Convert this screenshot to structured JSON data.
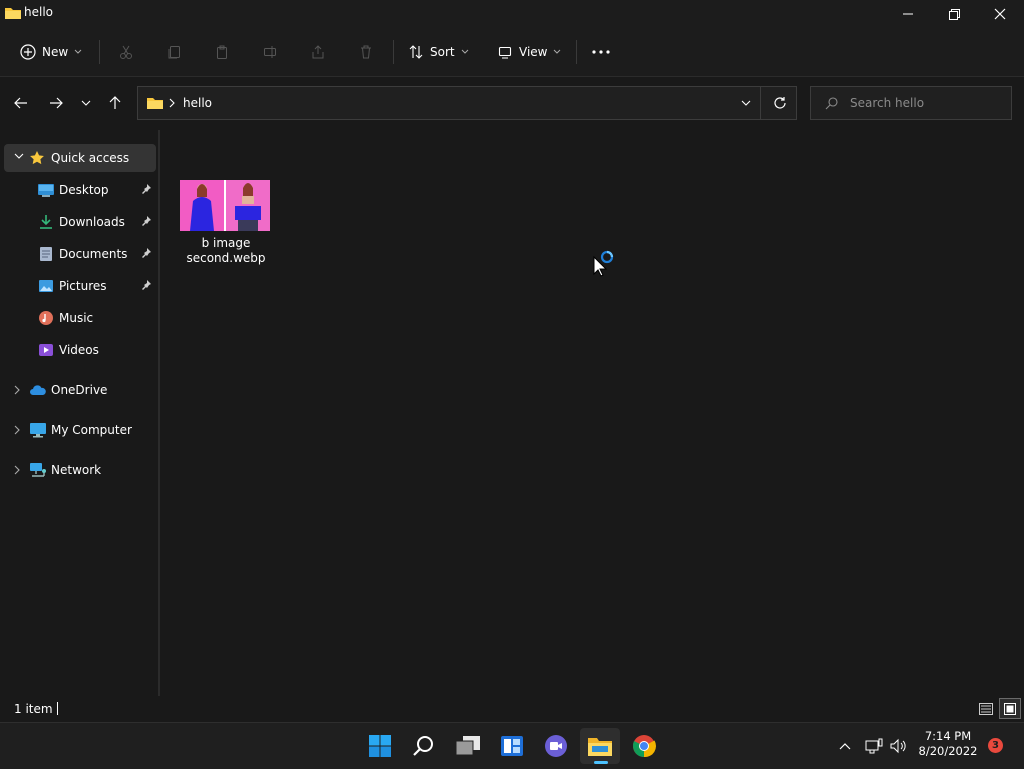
{
  "window": {
    "title": "hello"
  },
  "toolbar": {
    "new_label": "New",
    "sort_label": "Sort",
    "view_label": "View"
  },
  "address": {
    "crumb": "hello",
    "search_placeholder": "Search hello"
  },
  "sidebar": {
    "quick_access": "Quick access",
    "items": [
      {
        "label": "Desktop",
        "icon": "desktop-icon",
        "pinned": true
      },
      {
        "label": "Downloads",
        "icon": "download-icon",
        "pinned": true
      },
      {
        "label": "Documents",
        "icon": "document-icon",
        "pinned": true
      },
      {
        "label": "Pictures",
        "icon": "pictures-icon",
        "pinned": true
      },
      {
        "label": "Music",
        "icon": "music-icon",
        "pinned": false
      },
      {
        "label": "Videos",
        "icon": "videos-icon",
        "pinned": false
      }
    ],
    "onedrive": "OneDrive",
    "my_computer": "My Computer",
    "network": "Network"
  },
  "files": [
    {
      "name_line1": "b image",
      "name_line2": "second.webp"
    }
  ],
  "status": {
    "item_count": "1 item"
  },
  "taskbar": {
    "time": "7:14 PM",
    "date": "8/20/2022",
    "notifications": "3"
  },
  "colors": {
    "accent": "#4cc2ff",
    "folder": "#f8c73d",
    "thumb_pink": "#f25cc4",
    "thumb_blue": "#2b25e0",
    "badge": "#e9493d"
  }
}
